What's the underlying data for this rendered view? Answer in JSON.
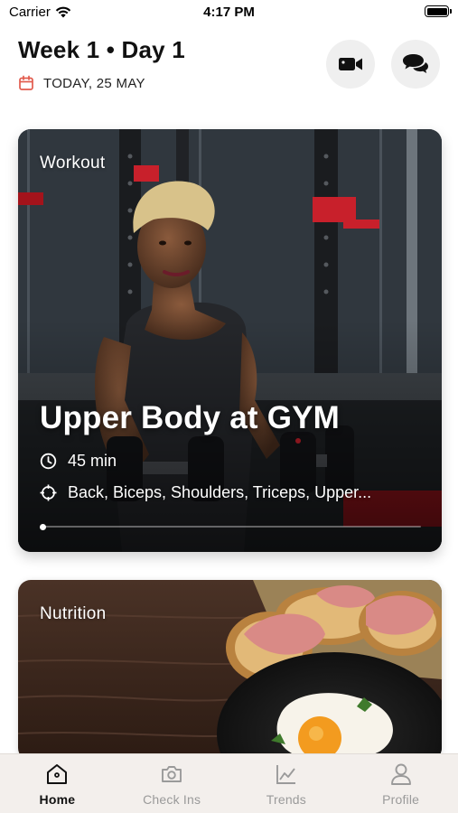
{
  "status_bar": {
    "carrier": "Carrier",
    "time": "4:17 PM"
  },
  "header": {
    "title": "Week 1 • Day 1",
    "date": "TODAY, 25 MAY"
  },
  "workout": {
    "label": "Workout",
    "title": "Upper Body at GYM",
    "duration": "45 min",
    "targets": "Back, Biceps, Shoulders, Triceps, Upper...",
    "progress": 0
  },
  "nutrition": {
    "label": "Nutrition"
  },
  "tabs": [
    {
      "label": "Home",
      "icon": "home-icon",
      "active": true
    },
    {
      "label": "Check Ins",
      "icon": "camera-icon",
      "active": false
    },
    {
      "label": "Trends",
      "icon": "trend-chart-icon",
      "active": false
    },
    {
      "label": "Profile",
      "icon": "person-icon",
      "active": false
    }
  ],
  "colors": {
    "accent": "#e25b4d",
    "tab_bar_bg": "#f3efec",
    "inactive": "#9a9a9a"
  }
}
